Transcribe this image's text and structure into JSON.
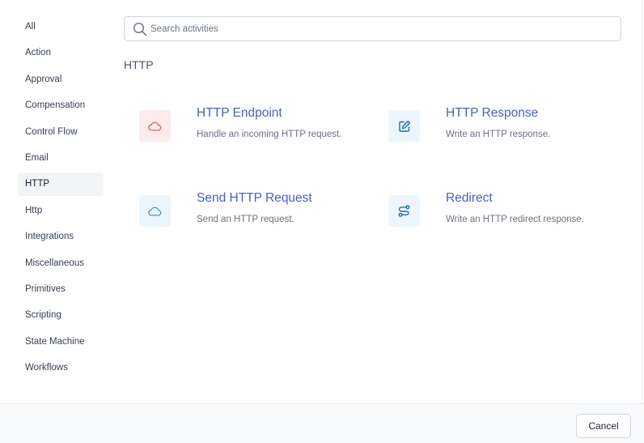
{
  "sidebar": {
    "items": [
      {
        "label": "All"
      },
      {
        "label": "Action"
      },
      {
        "label": "Approval"
      },
      {
        "label": "Compensation"
      },
      {
        "label": "Control Flow"
      },
      {
        "label": "Email"
      },
      {
        "label": "HTTP",
        "active": true
      },
      {
        "label": "Http"
      },
      {
        "label": "Integrations"
      },
      {
        "label": "Miscellaneous"
      },
      {
        "label": "Primitives"
      },
      {
        "label": "Scripting"
      },
      {
        "label": "State Machine"
      },
      {
        "label": "Workflows"
      }
    ]
  },
  "search": {
    "placeholder": "Search activities",
    "value": ""
  },
  "section": {
    "title": "HTTP"
  },
  "activities": [
    {
      "title": "HTTP Endpoint",
      "description": "Handle an incoming HTTP request.",
      "icon": "cloud-icon",
      "color": "#e0524f"
    },
    {
      "title": "HTTP Response",
      "description": "Write an HTTP response.",
      "icon": "edit-icon",
      "color": "#1d6fa5"
    },
    {
      "title": "Send HTTP Request",
      "description": "Send an HTTP request.",
      "icon": "cloud-icon",
      "color": "#3f8fc4"
    },
    {
      "title": "Redirect",
      "description": "Write an HTTP redirect response.",
      "icon": "route-icon",
      "color": "#1d6fa5"
    }
  ],
  "footer": {
    "cancel_label": "Cancel"
  }
}
